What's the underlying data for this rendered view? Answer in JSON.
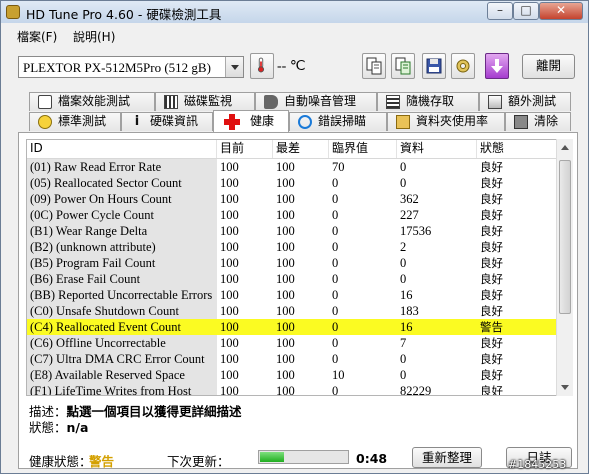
{
  "window": {
    "title": "HD Tune Pro 4.60 - 硬碟檢測工具"
  },
  "menu": {
    "file": "檔案(F)",
    "help": "說明(H)"
  },
  "toolbar": {
    "drive": "PLEXTOR PX-512M5Pro (512 gB)",
    "temperature": "-- ℃",
    "exit_label": "離開"
  },
  "tabs_top": [
    {
      "label": "檔案效能測試",
      "icon": "file-benchmark-icon"
    },
    {
      "label": "磁碟監視",
      "icon": "disk-monitor-icon"
    },
    {
      "label": "自動噪音管理",
      "icon": "speaker-icon"
    },
    {
      "label": "隨機存取",
      "icon": "random-access-icon"
    },
    {
      "label": "額外測試",
      "icon": "extra-tests-icon"
    }
  ],
  "tabs_bottom": [
    {
      "label": "標準測試",
      "icon": "benchmark-icon"
    },
    {
      "label": "硬碟資訊",
      "icon": "info-icon"
    },
    {
      "label": "健康",
      "icon": "health-cross-icon",
      "active": true
    },
    {
      "label": "錯誤掃瞄",
      "icon": "error-scan-icon"
    },
    {
      "label": "資料夾使用率",
      "icon": "folder-usage-icon"
    },
    {
      "label": "清除",
      "icon": "erase-icon"
    }
  ],
  "table": {
    "headers": [
      "ID",
      "目前",
      "最差",
      "臨界值",
      "資料",
      "狀態"
    ],
    "rows": [
      [
        "(01) Raw Read Error Rate",
        "100",
        "100",
        "70",
        "0",
        "良好"
      ],
      [
        "(05) Reallocated Sector Count",
        "100",
        "100",
        "0",
        "0",
        "良好"
      ],
      [
        "(09) Power On Hours Count",
        "100",
        "100",
        "0",
        "362",
        "良好"
      ],
      [
        "(0C) Power Cycle Count",
        "100",
        "100",
        "0",
        "227",
        "良好"
      ],
      [
        "(B1) Wear Range Delta",
        "100",
        "100",
        "0",
        "17536",
        "良好"
      ],
      [
        "(B2) (unknown attribute)",
        "100",
        "100",
        "0",
        "2",
        "良好"
      ],
      [
        "(B5) Program Fail Count",
        "100",
        "100",
        "0",
        "0",
        "良好"
      ],
      [
        "(B6) Erase Fail Count",
        "100",
        "100",
        "0",
        "0",
        "良好"
      ],
      [
        "(BB) Reported Uncorrectable Errors",
        "100",
        "100",
        "0",
        "16",
        "良好"
      ],
      [
        "(C0) Unsafe Shutdown Count",
        "100",
        "100",
        "0",
        "183",
        "良好"
      ],
      [
        "(C4) Reallocated Event Count",
        "100",
        "100",
        "0",
        "16",
        "警告"
      ],
      [
        "(C6) Offline Uncorrectable",
        "100",
        "100",
        "0",
        "7",
        "良好"
      ],
      [
        "(C7) Ultra DMA CRC Error Count",
        "100",
        "100",
        "0",
        "0",
        "良好"
      ],
      [
        "(E8) Available Reserved Space",
        "100",
        "100",
        "10",
        "0",
        "良好"
      ],
      [
        "(F1) LifeTime Writes from Host",
        "100",
        "100",
        "0",
        "82229",
        "良好"
      ]
    ],
    "highlighted_row": 10,
    "highlight_color": "#fbfb22"
  },
  "details": {
    "desc_label": "描述：",
    "desc_value": "點選一個項目以獲得更詳細描述",
    "status_label": "狀態：",
    "status_value": "n/a"
  },
  "footer": {
    "health_label": "健康狀態：",
    "health_value": "警告",
    "health_color": "#d4a000",
    "next_update_label": "下次更新：",
    "progress_fraction": 0.28,
    "time_left": "0:48",
    "rescan_label": "重新整理",
    "log_label": "日誌"
  },
  "watermark": "#1845253"
}
